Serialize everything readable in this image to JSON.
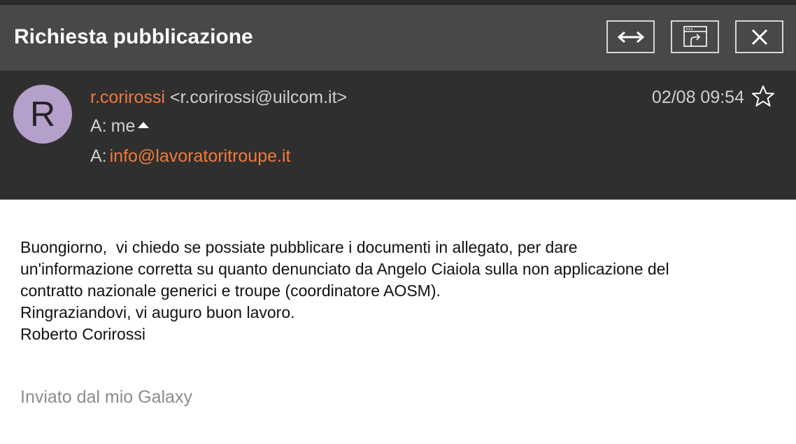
{
  "window": {
    "title": "Richiesta pubblicazione",
    "buttons": [
      {
        "name": "expand-button",
        "icon": "arrows-horizontal-icon"
      },
      {
        "name": "popout-button",
        "icon": "open-in-window-icon"
      },
      {
        "name": "close-button",
        "icon": "close-icon"
      }
    ]
  },
  "message": {
    "avatar_letter": "R",
    "avatar_color": "#b59fcb",
    "sender_name": "r.corirossi",
    "sender_email": "<r.corirossi@uilcom.it>",
    "date": "02/08 09:54",
    "to_label": "A:",
    "to_value": "me",
    "to2_label": "A:",
    "to2_value": "info@lavoratoritroupe.it",
    "body_lines": [
      "Buongiorno,  vi chiedo se possiate pubblicare i documenti in allegato, per dare",
      "un'informazione corretta su quanto denunciato da Angelo Ciaiola sulla non applicazione del",
      "contratto nazionale generici e troupe (coordinatore AOSM).",
      "Ringraziandovi, vi auguro buon lavoro.",
      "Roberto Corirossi"
    ],
    "signature": "Inviato dal mio Galaxy"
  },
  "colors": {
    "accent": "#f07a3c",
    "titlebar": "#484848",
    "header": "#2f2f2f"
  }
}
